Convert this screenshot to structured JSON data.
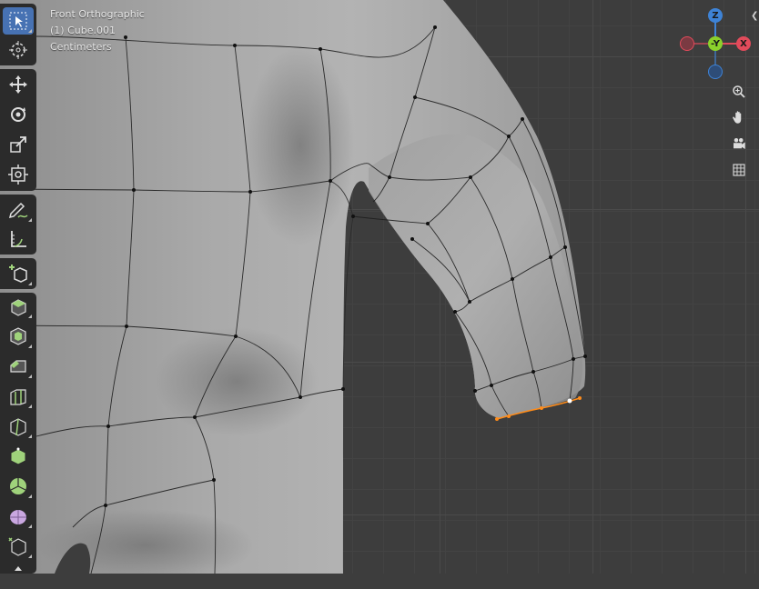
{
  "viewport": {
    "view_name": "Front Orthographic",
    "object_label": "(1) Cube.001",
    "units": "Centimeters"
  },
  "gizmo": {
    "z_label": "Z",
    "y_label": "-Y",
    "x_label": "X",
    "colors": {
      "x": "#e24b5b",
      "y": "#8bd12c",
      "z": "#3e83d6"
    }
  },
  "toolbar": {
    "tools": [
      {
        "name": "select-box",
        "icon": "select-box-icon",
        "active": true
      },
      {
        "name": "cursor",
        "icon": "cursor-icon"
      },
      {
        "name": "move",
        "icon": "move-icon"
      },
      {
        "name": "rotate",
        "icon": "rotate-icon"
      },
      {
        "name": "scale",
        "icon": "scale-icon"
      },
      {
        "name": "transform",
        "icon": "transform-icon"
      },
      {
        "name": "annotate",
        "icon": "annotate-icon"
      },
      {
        "name": "measure",
        "icon": "measure-icon"
      },
      {
        "name": "add-cube",
        "icon": "add-cube-icon"
      },
      {
        "name": "extrude",
        "icon": "extrude-icon"
      },
      {
        "name": "inset",
        "icon": "inset-icon"
      },
      {
        "name": "bevel",
        "icon": "bevel-icon"
      },
      {
        "name": "loop-cut",
        "icon": "loop-cut-icon"
      },
      {
        "name": "knife",
        "icon": "knife-icon"
      },
      {
        "name": "poly-build",
        "icon": "poly-build-icon"
      },
      {
        "name": "spin",
        "icon": "spin-icon"
      },
      {
        "name": "smooth",
        "icon": "smooth-icon"
      },
      {
        "name": "shear",
        "icon": "shear-icon"
      },
      {
        "name": "rip",
        "icon": "rip-icon"
      }
    ]
  },
  "nav_buttons": [
    {
      "name": "zoom",
      "icon": "zoom-icon"
    },
    {
      "name": "pan",
      "icon": "hand-icon"
    },
    {
      "name": "camera",
      "icon": "camera-icon"
    },
    {
      "name": "perspective",
      "icon": "grid-icon"
    }
  ],
  "colors": {
    "active_tool": "#4772b3",
    "selected_edge": "#ff8c1a",
    "mesh_surface": "#a6a6a6",
    "grid_background": "#3d3d3d"
  }
}
